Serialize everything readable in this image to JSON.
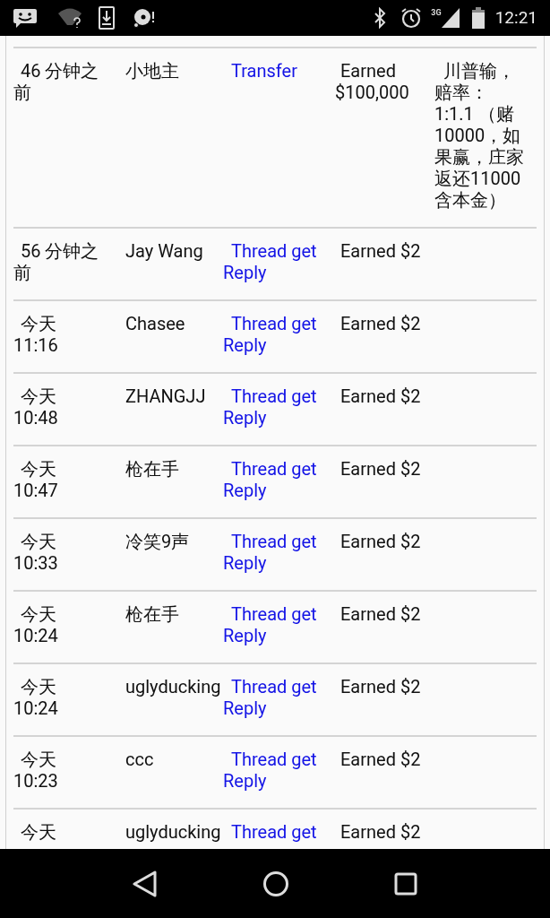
{
  "status_bar": {
    "network": "3G",
    "time": "12:21"
  },
  "rows": [
    {
      "time": "46 分钟之前",
      "user": "小地主",
      "action": "Transfer",
      "result": "Earned $100,000",
      "note": "川普输，赔率：1:1.1 （赌10000，如果赢，庄家返还11000含本金）"
    },
    {
      "time": "56 分钟之前",
      "user": "Jay Wang",
      "action": "Thread get Reply",
      "result": "Earned $2"
    },
    {
      "time": "今天 11:16",
      "user": "Chasee",
      "action": "Thread get Reply",
      "result": "Earned $2"
    },
    {
      "time": "今天 10:48",
      "user": "ZHANGJJ",
      "action": "Thread get Reply",
      "result": "Earned $2"
    },
    {
      "time": "今天 10:47",
      "user": "枪在手",
      "action": "Thread get Reply",
      "result": "Earned $2"
    },
    {
      "time": "今天 10:33",
      "user": "冷笑9声",
      "action": "Thread get Reply",
      "result": "Earned $2"
    },
    {
      "time": "今天 10:24",
      "user": "枪在手",
      "action": "Thread get Reply",
      "result": "Earned $2"
    },
    {
      "time": "今天 10:24",
      "user": "uglyducking",
      "action": "Thread get Reply",
      "result": "Earned $2"
    },
    {
      "time": "今天 10:23",
      "user": "ccc",
      "action": "Thread get Reply",
      "result": "Earned $2"
    },
    {
      "time": "今天",
      "user": "uglyducking",
      "action": "Thread get",
      "result": "Earned $2"
    }
  ]
}
